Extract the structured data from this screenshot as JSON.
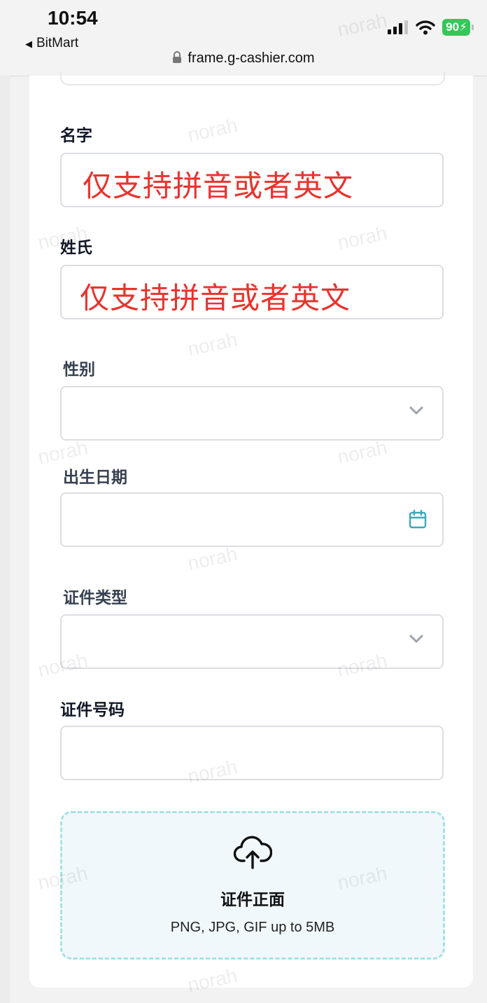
{
  "status_bar": {
    "time": "10:54",
    "back_app": "BitMart",
    "battery": "90",
    "url": "frame.g-cashier.com"
  },
  "form": {
    "first_name": {
      "label": "名字",
      "hint": "仅支持拼音或者英文"
    },
    "last_name": {
      "label": "姓氏",
      "hint": "仅支持拼音或者英文"
    },
    "gender": {
      "label": "性别",
      "value": ""
    },
    "birth_date": {
      "label": "出生日期",
      "value": ""
    },
    "id_type": {
      "label": "证件类型",
      "value": ""
    },
    "id_number": {
      "label": "证件号码",
      "value": ""
    },
    "upload": {
      "title": "证件正面",
      "subtitle": "PNG, JPG, GIF up to 5MB"
    }
  },
  "watermark": "norah",
  "colors": {
    "hint": "#e8332e",
    "accent": "#3aa9b8",
    "upload_border": "#a5e1e6"
  }
}
